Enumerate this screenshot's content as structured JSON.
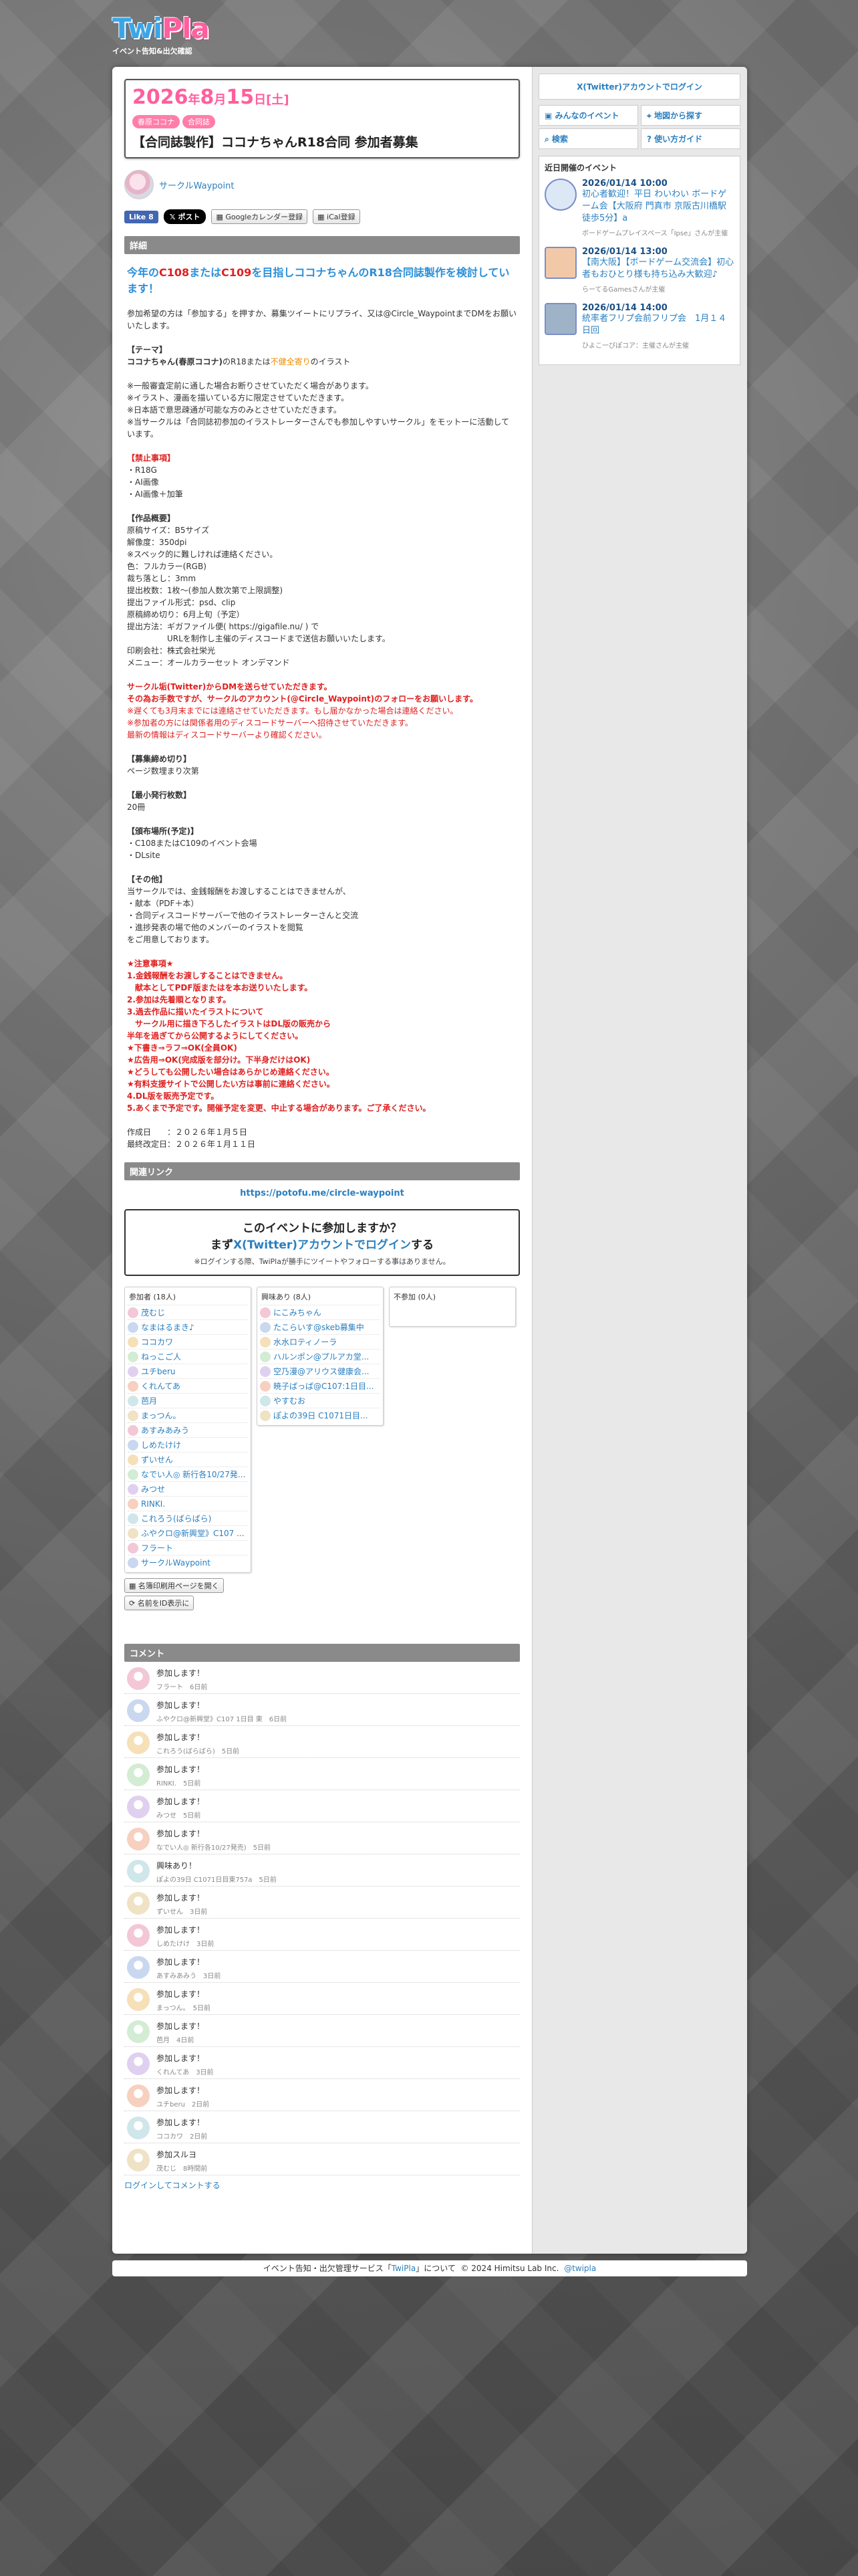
{
  "site": {
    "logo_a": "Twi",
    "logo_b": "Pla",
    "tagline": "イベント告知&出欠確認"
  },
  "event": {
    "year": "2026",
    "year_suffix": "年",
    "month": "8",
    "month_suffix": "月",
    "day": "15",
    "day_suffix": "日",
    "weekday": "[土]",
    "tags": [
      "春原ココナ",
      "合同誌"
    ],
    "title": "【合同誌製作】ココナちゃんR18合同 参加者募集",
    "organizer": "サークルWaypoint"
  },
  "share": {
    "like": "Like 8",
    "post": "ポスト",
    "gcal": "Googleカレンダー登録",
    "ical": "iCal登録"
  },
  "detail": {
    "heading": "詳細",
    "lead_1": "今年の",
    "lead_c108": "C108",
    "lead_2": "または",
    "lead_c109": "C109",
    "lead_3": "を目指しココナちゃんのR18合同誌製作を検討しています！",
    "p1": "参加希望の方は「参加する」を押すか、募集ツイートにリプライ、又は@Circle_WaypointまでDMをお願いいたします。",
    "theme_head": "【テーマ】",
    "theme_1a": "ココナちゃん(春原ココナ)",
    "theme_1b": "のR18または",
    "theme_1c": "不健全寄り",
    "theme_1d": "のイラスト",
    "theme_notes": "※一般審査定前に通した場合お断りさせていただく場合があります。\n※イラスト、漫画を描いている方に限定させていただきます。\n※日本語で意思疎通が可能な方のみとさせていただきます。\n※当サークルは「合同誌初参加のイラストレーターさんでも参加しやすいサークル」をモットーに活動しています。",
    "ban_head": "【禁止事項】",
    "ban_body": "・R18G\n・AI画像\n・AI画像＋加筆",
    "spec_head": "【作品概要】",
    "spec_body": "原稿サイズ：B5サイズ\n解像度：350dpi\n※スペック的に難しければ連絡ください。\n色：フルカラー(RGB)\n裁ち落とし：3mm\n提出枚数：1枚〜(参加人数次第で上限調整)\n提出ファイル形式：psd、clip\n原稿締め切り：6月上旬（予定）\n提出方法：ギガファイル便( https://gigafile.nu/ ) で\n　　　　　URLを制作し主催のディスコードまで送信お願いいたします。\n印刷会社：株式会社栄光\nメニュー：オールカラーセット オンデマンド",
    "contact_1": "サークル垢(Twitter)からDMを送らせていただきます。",
    "contact_2": "その為お手数ですが、サークルのアカウント(@Circle_Waypoint)のフォローをお願いします。",
    "contact_3": "※遅くても3月末までには連絡させていただきます。もし届かなかった場合は連絡ください。\n※参加者の方には関係者用のディスコードサーバーへ招待させていただきます。\n最新の情報はディスコードサーバーより確認ください。",
    "deadline_head": "【募集締め切り】",
    "deadline_body": "ページ数埋まり次第",
    "min_head": "【最小発行枚数】",
    "min_body": "20冊",
    "place_head": "【頒布場所(予定)】",
    "place_body": "・C108またはC109のイベント会場\n・DLsite",
    "other_head": "【その他】",
    "other_body": "当サークルでは、金銭報酬をお渡しすることはできませんが、\n・献本（PDF＋本）\n・合同ディスコードサーバーで他のイラストレーターさんと交流\n・進捗発表の場で他のメンバーのイラストを閲覧\nをご用意しております。",
    "notice_head": "★注意事項★",
    "notice_body": "1.金銭報酬をお渡しすることはできません。\n　献本としてPDF版またはを本お送りいたします。\n2.参加は先着順となります。\n3.過去作品に描いたイラストについて\n　サークル用に描き下ろしたイラストはDL版の販売から\n半年を過ぎてから公開するようにしてください。\n★下書き⇒ラフ⇒OK(全員OK)\n★広告用⇒OK(完成版を部分け。下半身だけはOK)\n★どうしても公開したい場合はあらかじめ連絡ください。\n★有料支援サイトで公開したい方は事前に連絡ください。\n4.DL版を販売予定です。\n5.あくまで予定です。開催予定を変更、中止する場合があります。ご了承ください。",
    "dates": "作成日　　：２０２６年１月５日\n最終改定日：２０２６年１月１１日"
  },
  "related": {
    "heading": "関連リンク",
    "url": "https://potofu.me/circle-waypoint"
  },
  "join": {
    "q1": "このイベントに参加しますか？",
    "q2_pre": "まず",
    "q2_link": "X(Twitter)アカウントでログイン",
    "q2_post": "する",
    "note": "※ログインする際、TwiPlaが勝手にツイートやフォローする事はありません。"
  },
  "attendees": {
    "going_head": "参加者 (18人)",
    "going": [
      "茂むじ",
      "なまはるまき♪",
      "ココカワ",
      "ねっこご人",
      "ユチberu",
      "くれんてあ",
      "芭月",
      "まっつん。",
      "あすみあみう",
      "しめたけけ",
      "ずいせん",
      "なでい人◎ 新行各10/27発...",
      "みつせ",
      "RINKI.",
      "これろう(ばらばら)",
      "ふやクロ@新興堂》C107 ...",
      "フラート",
      "サークルWaypoint"
    ],
    "maybe_head": "興味あり (8人)",
    "maybe": [
      "にこみちゃん",
      "たこらいす@skeb募集中",
      "水水ロティノーラ",
      "ハルンポン@プルアカ堂...",
      "空乃漫@アリウス健康会...",
      "暁子ぱっぱ@C107:1日目...",
      "やすむお",
      "ぽよの39日 C1071日目..."
    ],
    "no_head": "不参加 (0人)",
    "btn_print": "名簿印刷用ページを開く",
    "btn_id": "名前をID表示に"
  },
  "comments": {
    "heading": "コメント",
    "items": [
      {
        "text": "参加します！",
        "meta": "フラート　6日前"
      },
      {
        "text": "参加します！",
        "meta": "ふやクロ@新興堂》C107 1日目 東　6日前"
      },
      {
        "text": "参加します！",
        "meta": "これろう(ばらばら)　5日前"
      },
      {
        "text": "参加します！",
        "meta": "RINKI.　5日前"
      },
      {
        "text": "参加します！",
        "meta": "みつせ　5日前"
      },
      {
        "text": "参加します！",
        "meta": "なでい人◎ 新行各10/27発売)　5日前"
      },
      {
        "text": "興味あり！",
        "meta": "ぽよの39日 C1071日目東757a　5日前"
      },
      {
        "text": "参加します！",
        "meta": "ずいせん　3日前"
      },
      {
        "text": "参加します！",
        "meta": "しめたけけ　3日前"
      },
      {
        "text": "参加します！",
        "meta": "あすみあみう　3日前"
      },
      {
        "text": "参加します！",
        "meta": "まっつん。　5日前"
      },
      {
        "text": "参加します！",
        "meta": "芭月　4日前"
      },
      {
        "text": "参加します！",
        "meta": "くれんてあ　3日前"
      },
      {
        "text": "参加します！",
        "meta": "ユチberu　2日前"
      },
      {
        "text": "参加します！",
        "meta": "ココカワ　2日前"
      },
      {
        "text": "参加スルヨ",
        "meta": "茂むじ　8時間前"
      }
    ],
    "login_link": "ログインしてコメントする"
  },
  "sidebar": {
    "login_btn": "X(Twitter)アカウントでログイン",
    "nav": [
      "みんなのイベント",
      "地図から探す",
      "検索",
      "使い方ガイド"
    ],
    "upcoming_head": "近日開催のイベント",
    "upcoming": [
      {
        "date": "2026/01/14 10:00",
        "title": "初心者歓迎！平日 わいわい ボードゲーム会【大阪府 門真市 京阪古川橋駅 徒歩5分】a",
        "org": "ボードゲームプレイスペース「Ipse」さんが主催"
      },
      {
        "date": "2026/01/14 13:00",
        "title": "【南大阪】【ボードゲーム交流会】初心者もおひとり様も持ち込み大歓迎♪",
        "org": "らーてるGamesさんが主催"
      },
      {
        "date": "2026/01/14 14:00",
        "title": "統率者フリプ会前フリプ会　1月１４日回",
        "org": "ひよこ一ぴぽコア：主催さんが主催"
      }
    ]
  },
  "footer": {
    "pre": "イベント告知・出欠管理サービス「",
    "link": "TwiPla",
    "mid": "」について",
    "copy": "© 2024 Himitsu Lab Inc.",
    "handle": "@twipla"
  },
  "colors": {
    "accent": "#2a7fc0",
    "pink": "#ff5f9e",
    "red": "#e02020"
  }
}
